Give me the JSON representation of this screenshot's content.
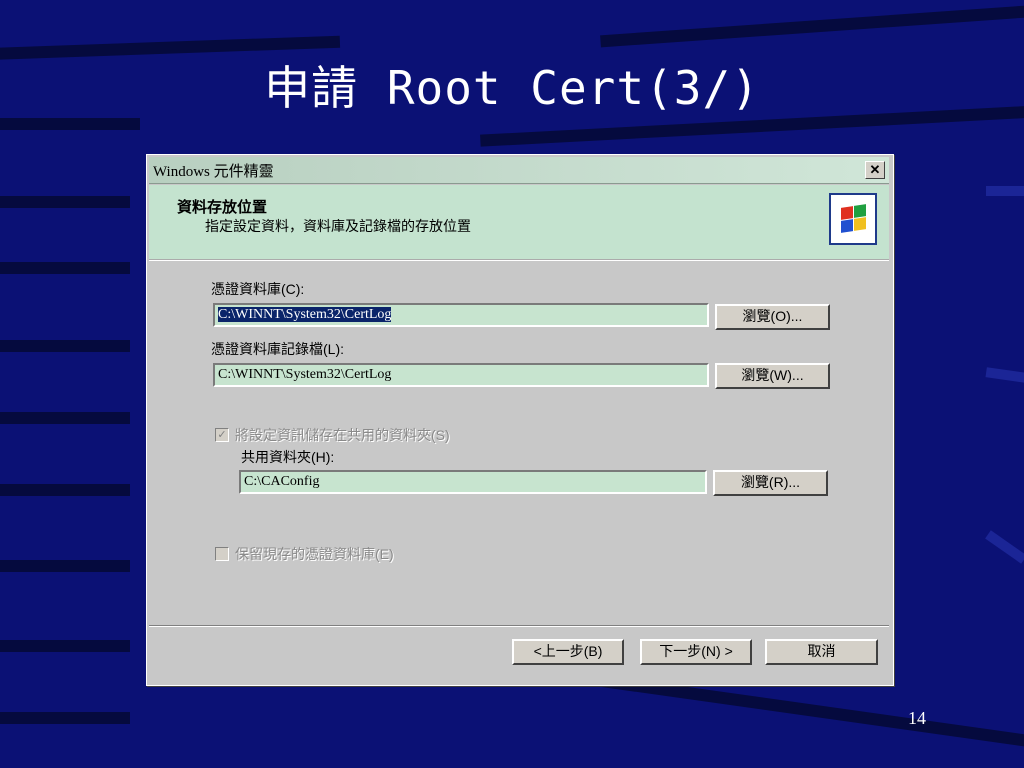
{
  "slide": {
    "title": "申請 Root Cert(3/)",
    "page_number": "14"
  },
  "dialog": {
    "window_title": "Windows 元件精靈",
    "close_glyph": "✕",
    "header_title": "資料存放位置",
    "header_subtitle": "指定設定資料，資料庫及記錄檔的存放位置",
    "db_label": "憑證資料庫(C):",
    "db_path": "C:\\WINNT\\System32\\CertLog",
    "db_browse": "瀏覽(O)...",
    "log_label": "憑證資料庫記錄檔(L):",
    "log_path": "C:\\WINNT\\System32\\CertLog",
    "log_browse": "瀏覽(W)...",
    "shared_check_label": "將設定資訊儲存在共用的資料夾(S)",
    "shared_check_mark": "✓",
    "shared_folder_label": "共用資料夾(H):",
    "shared_folder_path": "C:\\CAConfig",
    "shared_browse": "瀏覽(R)...",
    "keep_db_label": "保留現存的憑證資料庫(E)",
    "back_button": "<上一步(B)",
    "next_button": "下一步(N) >",
    "cancel_button": "取消"
  }
}
